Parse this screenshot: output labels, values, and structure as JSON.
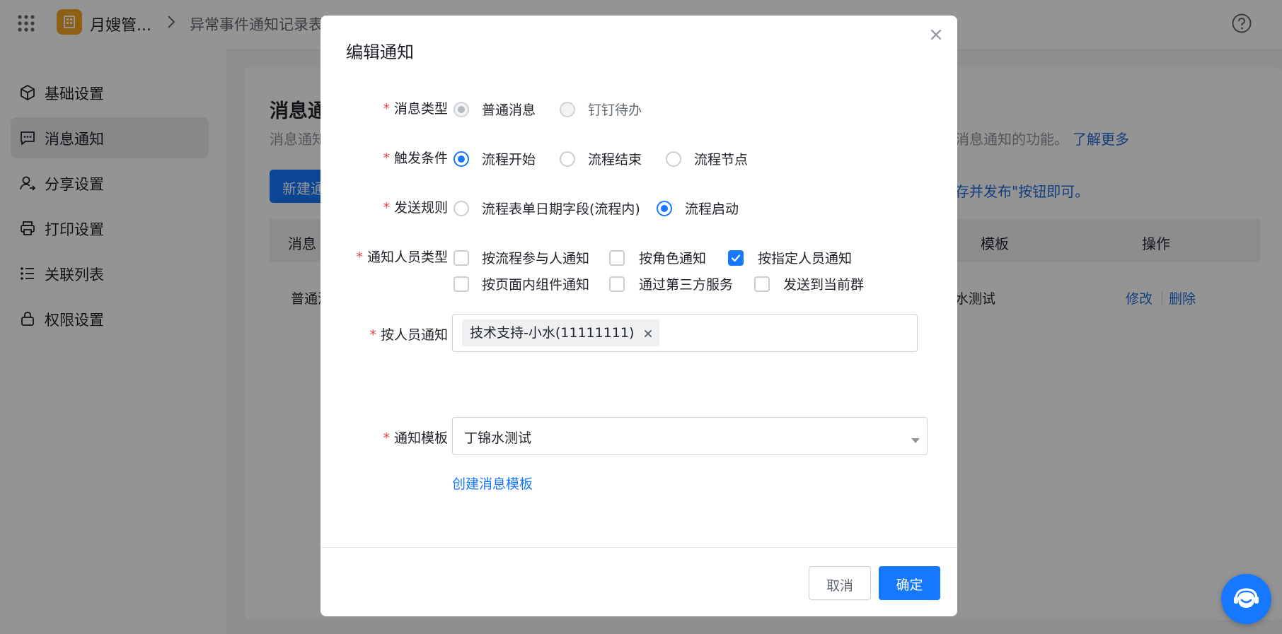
{
  "topbar": {
    "app_name": "月嫂管...",
    "breadcrumb_form": "异常事件通知记录表"
  },
  "sidebar": {
    "items": [
      {
        "label": "基础设置",
        "icon": "cube-icon",
        "active": false
      },
      {
        "label": "消息通知",
        "icon": "message-icon",
        "active": true
      },
      {
        "label": "分享设置",
        "icon": "share-user-icon",
        "active": false
      },
      {
        "label": "打印设置",
        "icon": "printer-icon",
        "active": false
      },
      {
        "label": "关联列表",
        "icon": "list-icon",
        "active": false
      },
      {
        "label": "权限设置",
        "icon": "lock-icon",
        "active": false
      }
    ]
  },
  "main": {
    "title": "消息通",
    "desc_start": "消息通知",
    "desc_end": "消息通知的功能。",
    "learn_more": "了解更多",
    "new_button": "新建通",
    "publish_tip": "存并发布\"按钮即可。",
    "table": {
      "headers": [
        "消息",
        "模板",
        "操作"
      ],
      "row": {
        "type": "普通消",
        "template": "水测试",
        "edit": "修改",
        "delete": "删除"
      }
    }
  },
  "dialog": {
    "title": "编辑通知",
    "message_type": {
      "label": "消息类型",
      "options": [
        "普通消息",
        "钉钉待办"
      ],
      "selected": "普通消息"
    },
    "trigger": {
      "label": "触发条件",
      "options": [
        "流程开始",
        "流程结束",
        "流程节点"
      ],
      "selected": "流程开始"
    },
    "send_rule": {
      "label": "发送规则",
      "options": [
        "流程表单日期字段(流程内)",
        "流程启动"
      ],
      "selected": "流程启动"
    },
    "notify_type": {
      "label": "通知人员类型",
      "options": [
        {
          "label": "按流程参与人通知",
          "checked": false
        },
        {
          "label": "按角色通知",
          "checked": false
        },
        {
          "label": "按指定人员通知",
          "checked": true
        },
        {
          "label": "按页面内组件通知",
          "checked": false
        },
        {
          "label": "通过第三方服务",
          "checked": false
        },
        {
          "label": "发送到当前群",
          "checked": false
        }
      ]
    },
    "person": {
      "label": "按人员通知",
      "tags": [
        "技术支持-小水(11111111)"
      ]
    },
    "template": {
      "label": "通知模板",
      "value": "丁锦水测试"
    },
    "create_template_link": "创建消息模板",
    "cancel": "取消",
    "confirm": "确定"
  },
  "colors": {
    "primary": "#1677ff",
    "required": "#e54545",
    "app_logo": "#f5a623"
  }
}
